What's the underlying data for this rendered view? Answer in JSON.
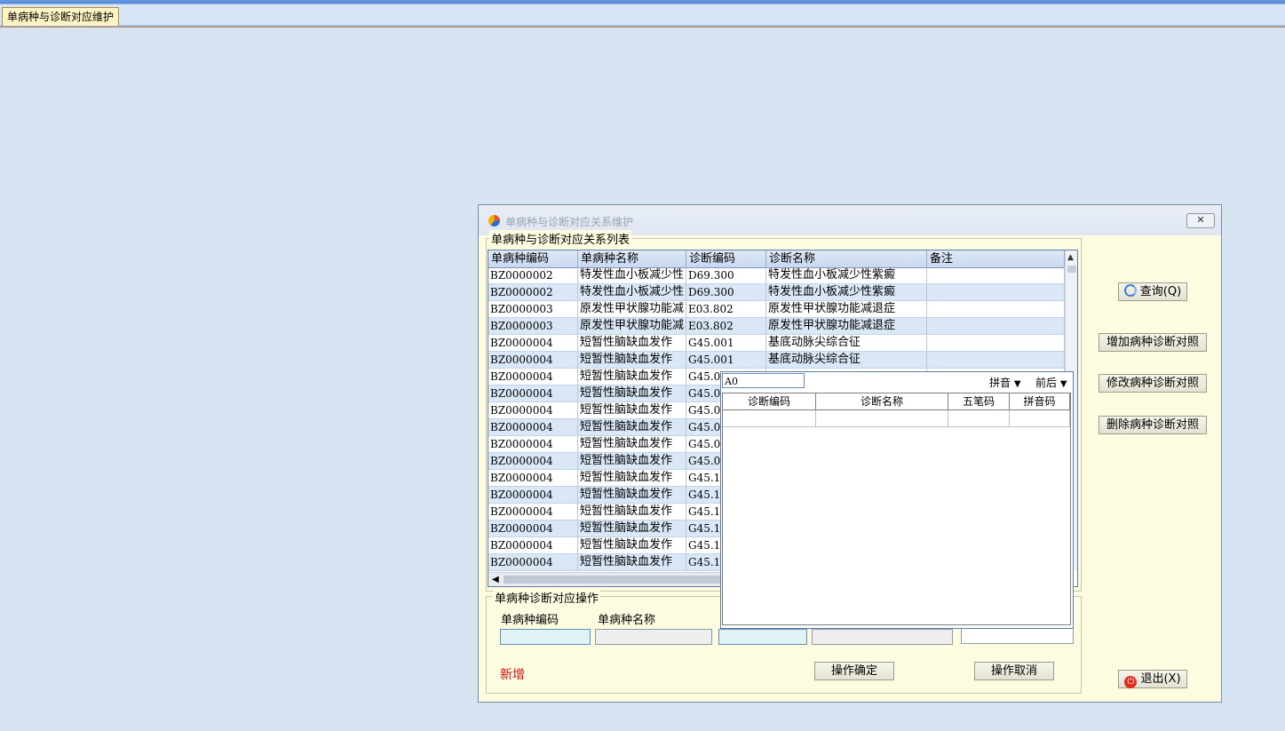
{
  "main_tab": {
    "label": "单病种与诊断对应维护"
  },
  "dialog": {
    "title": "单病种与诊断对应关系维护",
    "close_label": "✕"
  },
  "list_group": {
    "legend": "单病种与诊断对应关系列表"
  },
  "grid": {
    "columns": [
      "单病种编码",
      "单病种名称",
      "诊断编码",
      "诊断名称",
      "备注"
    ],
    "rows": [
      {
        "code": "BZ0000002",
        "name": "特发性血小板减少性",
        "diag_code": "D69.300",
        "diag_name": "特发性血小板减少性紫癜",
        "note": ""
      },
      {
        "code": "BZ0000002",
        "name": "特发性血小板减少性",
        "diag_code": "D69.300",
        "diag_name": "特发性血小板减少性紫癜",
        "note": ""
      },
      {
        "code": "BZ0000003",
        "name": "原发性甲状腺功能减",
        "diag_code": "E03.802",
        "diag_name": "原发性甲状腺功能减退症",
        "note": ""
      },
      {
        "code": "BZ0000003",
        "name": "原发性甲状腺功能减",
        "diag_code": "E03.802",
        "diag_name": "原发性甲状腺功能减退症",
        "note": ""
      },
      {
        "code": "BZ0000004",
        "name": "短暂性脑缺血发作",
        "diag_code": "G45.001",
        "diag_name": "基底动脉尖综合征",
        "note": ""
      },
      {
        "code": "BZ0000004",
        "name": "短暂性脑缺血发作",
        "diag_code": "G45.001",
        "diag_name": "基底动脉尖综合征",
        "note": ""
      },
      {
        "code": "BZ0000004",
        "name": "短暂性脑缺血发作",
        "diag_code": "G45.0",
        "diag_name": "",
        "note": ""
      },
      {
        "code": "BZ0000004",
        "name": "短暂性脑缺血发作",
        "diag_code": "G45.0",
        "diag_name": "",
        "note": ""
      },
      {
        "code": "BZ0000004",
        "name": "短暂性脑缺血发作",
        "diag_code": "G45.0",
        "diag_name": "",
        "note": ""
      },
      {
        "code": "BZ0000004",
        "name": "短暂性脑缺血发作",
        "diag_code": "G45.0",
        "diag_name": "",
        "note": ""
      },
      {
        "code": "BZ0000004",
        "name": "短暂性脑缺血发作",
        "diag_code": "G45.0",
        "diag_name": "",
        "note": ""
      },
      {
        "code": "BZ0000004",
        "name": "短暂性脑缺血发作",
        "diag_code": "G45.0",
        "diag_name": "",
        "note": ""
      },
      {
        "code": "BZ0000004",
        "name": "短暂性脑缺血发作",
        "diag_code": "G45.1",
        "diag_name": "",
        "note": ""
      },
      {
        "code": "BZ0000004",
        "name": "短暂性脑缺血发作",
        "diag_code": "G45.1",
        "diag_name": "",
        "note": ""
      },
      {
        "code": "BZ0000004",
        "name": "短暂性脑缺血发作",
        "diag_code": "G45.1",
        "diag_name": "",
        "note": ""
      },
      {
        "code": "BZ0000004",
        "name": "短暂性脑缺血发作",
        "diag_code": "G45.1",
        "diag_name": "",
        "note": ""
      },
      {
        "code": "BZ0000004",
        "name": "短暂性脑缺血发作",
        "diag_code": "G45.1",
        "diag_name": "",
        "note": ""
      },
      {
        "code": "BZ0000004",
        "name": "短暂性脑缺血发作",
        "diag_code": "G45.1",
        "diag_name": "",
        "note": ""
      }
    ]
  },
  "popup": {
    "search_value": "A0",
    "select_mode": "拼音",
    "select_match": "前后",
    "columns": [
      "诊断编码",
      "诊断名称",
      "五笔码",
      "拼音码"
    ]
  },
  "operation_group": {
    "legend": "单病种诊断对应操作",
    "label_code": "单病种编码",
    "label_name": "单病种名称",
    "status": "新增",
    "confirm_label": "操作确定",
    "cancel_label": "操作取消"
  },
  "side_buttons": {
    "query": "查询(Q)",
    "add": "增加病种诊断对照",
    "modify": "修改病种诊断对照",
    "delete": "删除病种诊断对照",
    "exit": "退出(X)"
  },
  "colors": {
    "accent": "#d41010",
    "dialog_bg": "#fdfbe0",
    "row_alt": "#d9e7f6",
    "page_bg": "#d6e4f1"
  }
}
